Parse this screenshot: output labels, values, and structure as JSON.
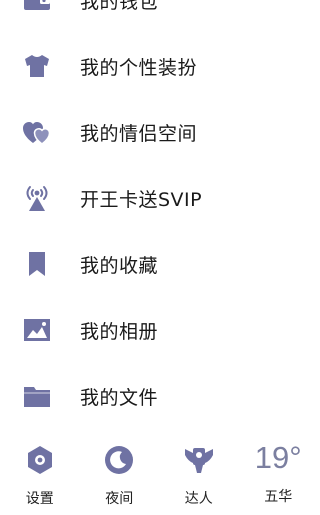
{
  "theme": {
    "icon_color": "#6f72a3",
    "text_color": "#1a1a1a"
  },
  "menu": {
    "items": [
      {
        "label": "我的钱包",
        "icon": "wallet-icon"
      },
      {
        "label": "我的个性装扮",
        "icon": "tshirt-icon"
      },
      {
        "label": "我的情侣空间",
        "icon": "hearts-icon"
      },
      {
        "label": "开王卡送SVIP",
        "icon": "signal-tower-icon"
      },
      {
        "label": "我的收藏",
        "icon": "bookmark-icon"
      },
      {
        "label": "我的相册",
        "icon": "photo-icon"
      },
      {
        "label": "我的文件",
        "icon": "folder-icon"
      }
    ]
  },
  "bottom_bar": {
    "settings": {
      "label": "设置",
      "icon": "hexagon-gear-icon"
    },
    "night": {
      "label": "夜间",
      "icon": "moon-icon"
    },
    "expert": {
      "label": "达人",
      "icon": "winged-badge-icon"
    },
    "weather": {
      "label": "五华",
      "temperature": "19°"
    }
  }
}
